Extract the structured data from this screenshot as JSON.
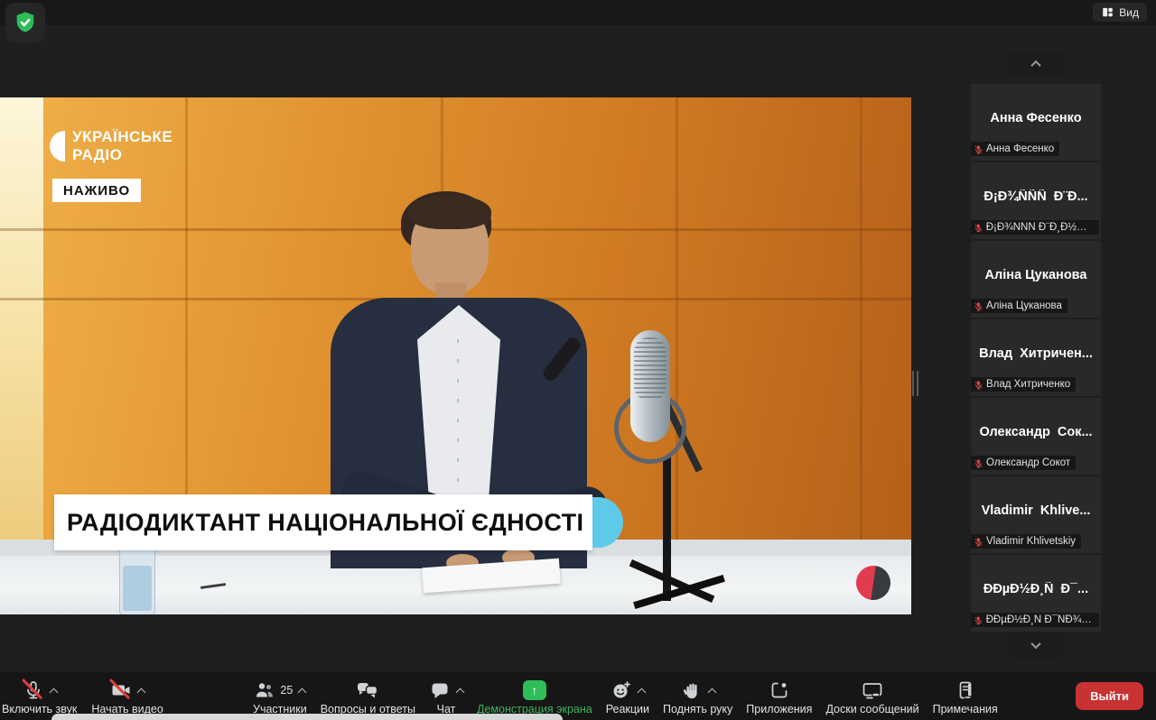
{
  "top_bar": {
    "view_label": "Вид"
  },
  "video": {
    "station_line1": "УКРАЇНСЬКЕ",
    "station_line2": "РАДІО",
    "live_badge": "НАЖИВО",
    "banner_text": "РАДІОДИКТАНТ НАЦІОНАЛЬНОЇ ЄДНОСТІ"
  },
  "participants": [
    {
      "name": "Анна Фесенко",
      "label": "Анна Фесенко"
    },
    {
      "name": "Đ¡Đ¾ÑÑÑ  Đ¨Đ...",
      "label": "Đ¡Đ¾ÑÑÑ Đ¨Đ¸Đ½Đ°..."
    },
    {
      "name": "Аліна Цуканова",
      "label": "Аліна Цуканова"
    },
    {
      "name": "Влад  Хитричен...",
      "label": "Влад Хитриченко"
    },
    {
      "name": "Олександр  Сок...",
      "label": "Олександр Сокот"
    },
    {
      "name": "Vladimir  Khlive...",
      "label": "Vladimir Khlivetskiy"
    },
    {
      "name": "ĐĐµĐ½Đ¸Ñ  Đ¯...",
      "label": "ĐĐµĐ½Đ¸Ñ Đ¯ÑĐ¾Ñ..."
    }
  ],
  "toolbar": {
    "mute_label": "Включить звук",
    "video_label": "Начать видео",
    "participants_label": "Участники",
    "participants_count": "25",
    "qa_label": "Вопросы и ответы",
    "chat_label": "Чат",
    "share_label": "Демонстрация экрана",
    "share_arrow": "↑",
    "reactions_label": "Реакции",
    "raise_hand_label": "Поднять руку",
    "apps_label": "Приложения",
    "whiteboards_label": "Доски сообщений",
    "notes_label": "Примечания",
    "leave_label": "Выйти"
  },
  "colors": {
    "share_green": "#2ebd59",
    "leave_red": "#c83232",
    "accent_blue": "#5fc9e9",
    "wall_orange": "#d98a28",
    "logo_red": "#e23b50",
    "mute_red": "#e03c3c"
  }
}
